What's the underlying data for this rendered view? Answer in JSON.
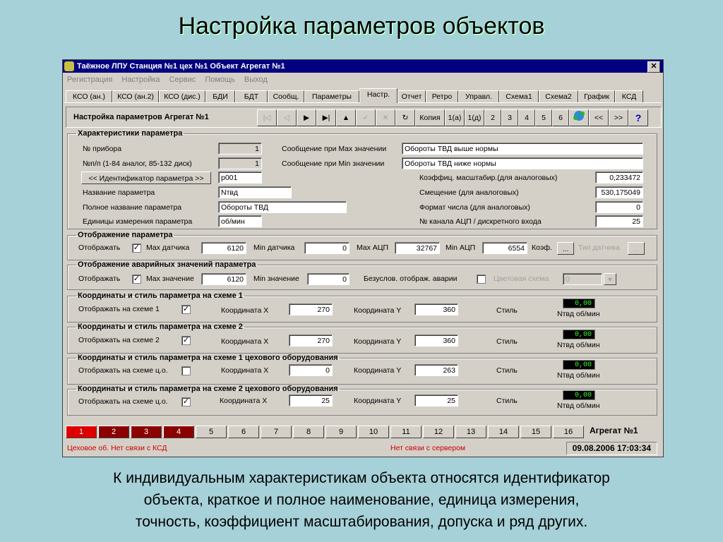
{
  "slide": {
    "title": "Настройка параметров объектов",
    "caption_line1": "К индивидуальным характеристикам объекта относятся идентификатор",
    "caption_line2": "объекта, краткое и полное наименование, единица измерения,",
    "caption_line3": "точность,  коэффициент масштабирования, допуска и ряд  других."
  },
  "window": {
    "title": "Таёжное  ЛПУ Станция №1  цех №1  Объект Агрегат №1",
    "close": "✕"
  },
  "menu": [
    "Регистрация",
    "Настройка",
    "Сервис",
    "Помощь",
    "Выход"
  ],
  "tabs": [
    "КСО (ан.)",
    "КСО (ан.2)",
    "КСО (дис.)",
    "БДИ",
    "БДТ",
    "Сообщ.",
    "Параметры",
    "Настр.",
    "Отчет",
    "Ретро",
    "Управл.",
    "Схема1",
    "Схема2",
    "График",
    "КСД"
  ],
  "toolbar": {
    "title": "Настройка параметров Агрегат №1",
    "copy": "Копия",
    "b1a": "1(а)",
    "b1d": "1(д)",
    "nums": [
      "2",
      "3",
      "4",
      "5",
      "6"
    ],
    "prev": "<<",
    "next": ">>",
    "help": "?"
  },
  "char": {
    "legend": "Характеристики параметра",
    "device_label": "№ прибора",
    "device_value": "1",
    "np_label": "№п/п (1-84 аналог, 85-132 диск)",
    "np_value": "1",
    "id_button": "<< Идентификатор параметра >>",
    "id_value": "p001",
    "name_label": "Название параметра",
    "name_value": "Nтвд",
    "full_label": "Полное название параметра",
    "full_value": "Обороты ТВД",
    "units_label": "Единицы измерения параметра",
    "units_value": "об/мин",
    "max_msg_label": "Сообщение при Max значении",
    "max_msg_value": "Обороты ТВД выше нормы",
    "min_msg_label": "Сообщение при Min значении",
    "min_msg_value": "Обороты ТВД ниже нормы",
    "scale_label": "Коэффиц. масштабир.(для аналоговых)",
    "scale_value": "0,233472",
    "offset_label": "Смещение (для аналоговых)",
    "offset_value": "530,175049",
    "format_label": "Формат числа (для аналоговых)",
    "format_value": "0",
    "channel_label": "№ канала АЦП / дискретного входа",
    "channel_value": "25"
  },
  "display": {
    "legend": "Отображение параметра",
    "show_label": "Отображать",
    "check": "✓",
    "max_sensor_label": "Max датчика",
    "max_sensor_value": "6120",
    "min_sensor_label": "Min датчика",
    "min_sensor_value": "0",
    "max_adc_label": "Max АЦП",
    "max_adc_value": "32767",
    "min_adc_label": "Min АЦП",
    "min_adc_value": "6554",
    "coef_label": "Коэф.",
    "dots": "...",
    "type_label": "Тип датчика"
  },
  "alarm": {
    "legend": "Отображение аварийных значений параметра",
    "show_label": "Отображать",
    "check": "✓",
    "max_label": "Max значение",
    "max_value": "6120",
    "min_label": "Min значение",
    "min_value": "0",
    "uncond_label": "Безуслов. отображ. аварии",
    "color_label": "Цветовая схема",
    "color_value": "0",
    "dropdown": "▼"
  },
  "schemes": [
    {
      "legend": "Координаты и стиль параметра на схеме 1",
      "show_label": "Отображать на схеме 1",
      "checked": "✓",
      "x_label": "Координата X",
      "x": "270",
      "y_label": "Координата Y",
      "y": "360",
      "style_label": "Стиль",
      "lcd": "0,00",
      "ind": "Nтвд об/мин"
    },
    {
      "legend": "Координаты и стиль параметра на схеме 2",
      "show_label": "Отображать на схеме 2",
      "checked": "✓",
      "x_label": "Координата X",
      "x": "270",
      "y_label": "Координата Y",
      "y": "360",
      "style_label": "Стиль",
      "lcd": "0,00",
      "ind": "Nтвд об/мин"
    },
    {
      "legend": "Координаты и стиль параметра на схеме 1 цехового оборудования",
      "show_label": "Отображать на схеме ц.о.",
      "checked": "",
      "x_label": "Координата X",
      "x": "0",
      "y_label": "Координата Y",
      "y": "263",
      "style_label": "Стиль",
      "lcd": "0,00",
      "ind": "Nтвд об/мин"
    },
    {
      "legend": "Координаты и стиль параметра на схеме 2 цехового оборудования",
      "show_label": "Отображать на схеме ц.о.",
      "checked": "✓",
      "x_label": "Координата X",
      "x": "25",
      "y_label": "Координата Y",
      "y": "25",
      "style_label": "Стиль",
      "lcd": "0,00",
      "ind": "Nтвд об/мин"
    }
  ],
  "pages": [
    "1",
    "2",
    "3",
    "4",
    "5",
    "6",
    "7",
    "8",
    "9",
    "10",
    "11",
    "12",
    "13",
    "14",
    "15",
    "16"
  ],
  "aggregate": "Агрегат №1",
  "status": {
    "left": "Цеховое об. Нет связи с КСД",
    "center": "Нет связи с сервером",
    "datetime": "09.08.2006 17:03:34"
  },
  "colors": {
    "title_bar": "#000080",
    "active_page": "#dd0000",
    "alarm_page": "#8b0000",
    "lcd": "#33ff33"
  }
}
